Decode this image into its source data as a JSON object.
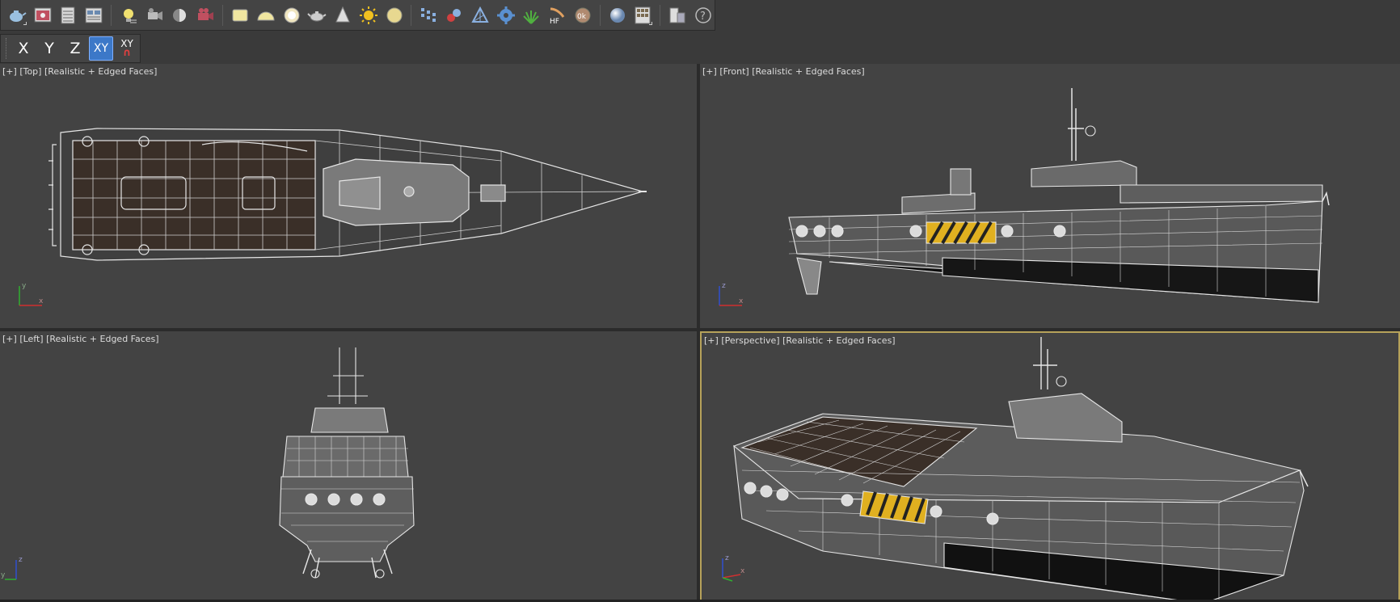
{
  "main_toolbar": {
    "icons": [
      "teapot-icon",
      "render-frame-icon",
      "render-setup-icon",
      "rendered-frame-window-icon",
      "light-lister-icon",
      "camera-icon",
      "omni-light-icon",
      "camera-sequence-icon",
      "plane-icon",
      "dome-icon",
      "sphere-light-icon",
      "teapot-object-icon",
      "cone-icon",
      "sun-icon",
      "disc-icon",
      "grid-array-icon",
      "particle-icon",
      "geometry-icon",
      "gear-icon",
      "grass-icon",
      "hf-hair-icon",
      "0k-material-icon",
      "sphere-material-icon",
      "material-editor-icon",
      "scene-converter-icon",
      "help-icon"
    ],
    "hf_label": "HF",
    "ok_label": "0k"
  },
  "axis_toolbar": {
    "x": "X",
    "y": "Y",
    "z": "Z",
    "xy": "XY",
    "xy_snap": "XY",
    "snap_glyph": "∩",
    "active": "XY"
  },
  "viewports": {
    "top": {
      "plus": "[+]",
      "name": "[Top]",
      "shading": "[Realistic + Edged Faces]"
    },
    "front": {
      "plus": "[+]",
      "name": "[Front]",
      "shading": "[Realistic + Edged Faces]"
    },
    "left": {
      "plus": "[+]",
      "name": "[Left]",
      "shading": "[Realistic + Edged Faces]"
    },
    "perspective": {
      "plus": "[+]",
      "name": "[Perspective]",
      "shading": "[Realistic + Edged Faces]",
      "active": true
    }
  },
  "gizmo_labels": {
    "top": [
      "y",
      "x"
    ],
    "front": [
      "z",
      "x"
    ],
    "left": [
      "z",
      "y"
    ],
    "perspective": [
      "z",
      "x"
    ]
  },
  "colors": {
    "viewport_bg": "#434343",
    "active_border": "#b6a25a",
    "wire": "#e8e8e8",
    "deck": "#3a2f28",
    "hazard_yellow": "#e0b020",
    "axis_x": "#d03030",
    "axis_y": "#30b030",
    "axis_z": "#3050d0"
  }
}
